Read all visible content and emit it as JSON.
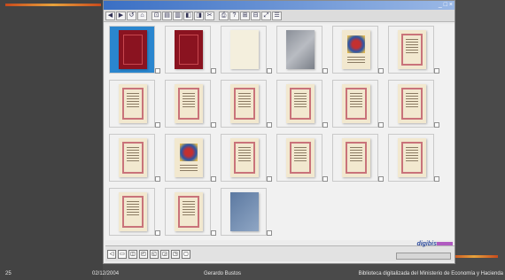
{
  "window": {
    "controls": "_ □ ×"
  },
  "toolbar": {
    "buttons": [
      "◀",
      "▶",
      "↺",
      "⌂",
      "⊡",
      "▤",
      "▥",
      "◧",
      "◨",
      "✂",
      "⎙",
      "?",
      "⊞",
      "⊟",
      "⤢",
      "☰"
    ]
  },
  "thumbnails": [
    {
      "style": "red",
      "selected": true
    },
    {
      "style": "red",
      "selected": false
    },
    {
      "style": "plain",
      "selected": false
    },
    {
      "style": "gray",
      "selected": false
    },
    {
      "style": "illum",
      "selected": false
    },
    {
      "style": "ms",
      "selected": false
    },
    {
      "style": "ms",
      "selected": false
    },
    {
      "style": "ms",
      "selected": false
    },
    {
      "style": "ms",
      "selected": false
    },
    {
      "style": "ms",
      "selected": false
    },
    {
      "style": "ms",
      "selected": false
    },
    {
      "style": "ms",
      "selected": false
    },
    {
      "style": "ms",
      "selected": false
    },
    {
      "style": "illum",
      "selected": false
    },
    {
      "style": "ms",
      "selected": false
    },
    {
      "style": "ms",
      "selected": false
    },
    {
      "style": "ms",
      "selected": false
    },
    {
      "style": "ms",
      "selected": false
    },
    {
      "style": "ms",
      "selected": false
    },
    {
      "style": "ms",
      "selected": false
    },
    {
      "style": "blue",
      "selected": false
    }
  ],
  "nav": {
    "buttons": [
      "◁",
      "▭",
      "◫",
      "◰",
      "◱",
      "◲",
      "◳",
      "▢"
    ]
  },
  "brand": "digibis",
  "footer": {
    "slide_number": "25",
    "date": "02/12/2004",
    "author": "Gerardo Bustos",
    "title": "Biblioteca digitalizada del Ministerio de Economía y Hacienda"
  }
}
